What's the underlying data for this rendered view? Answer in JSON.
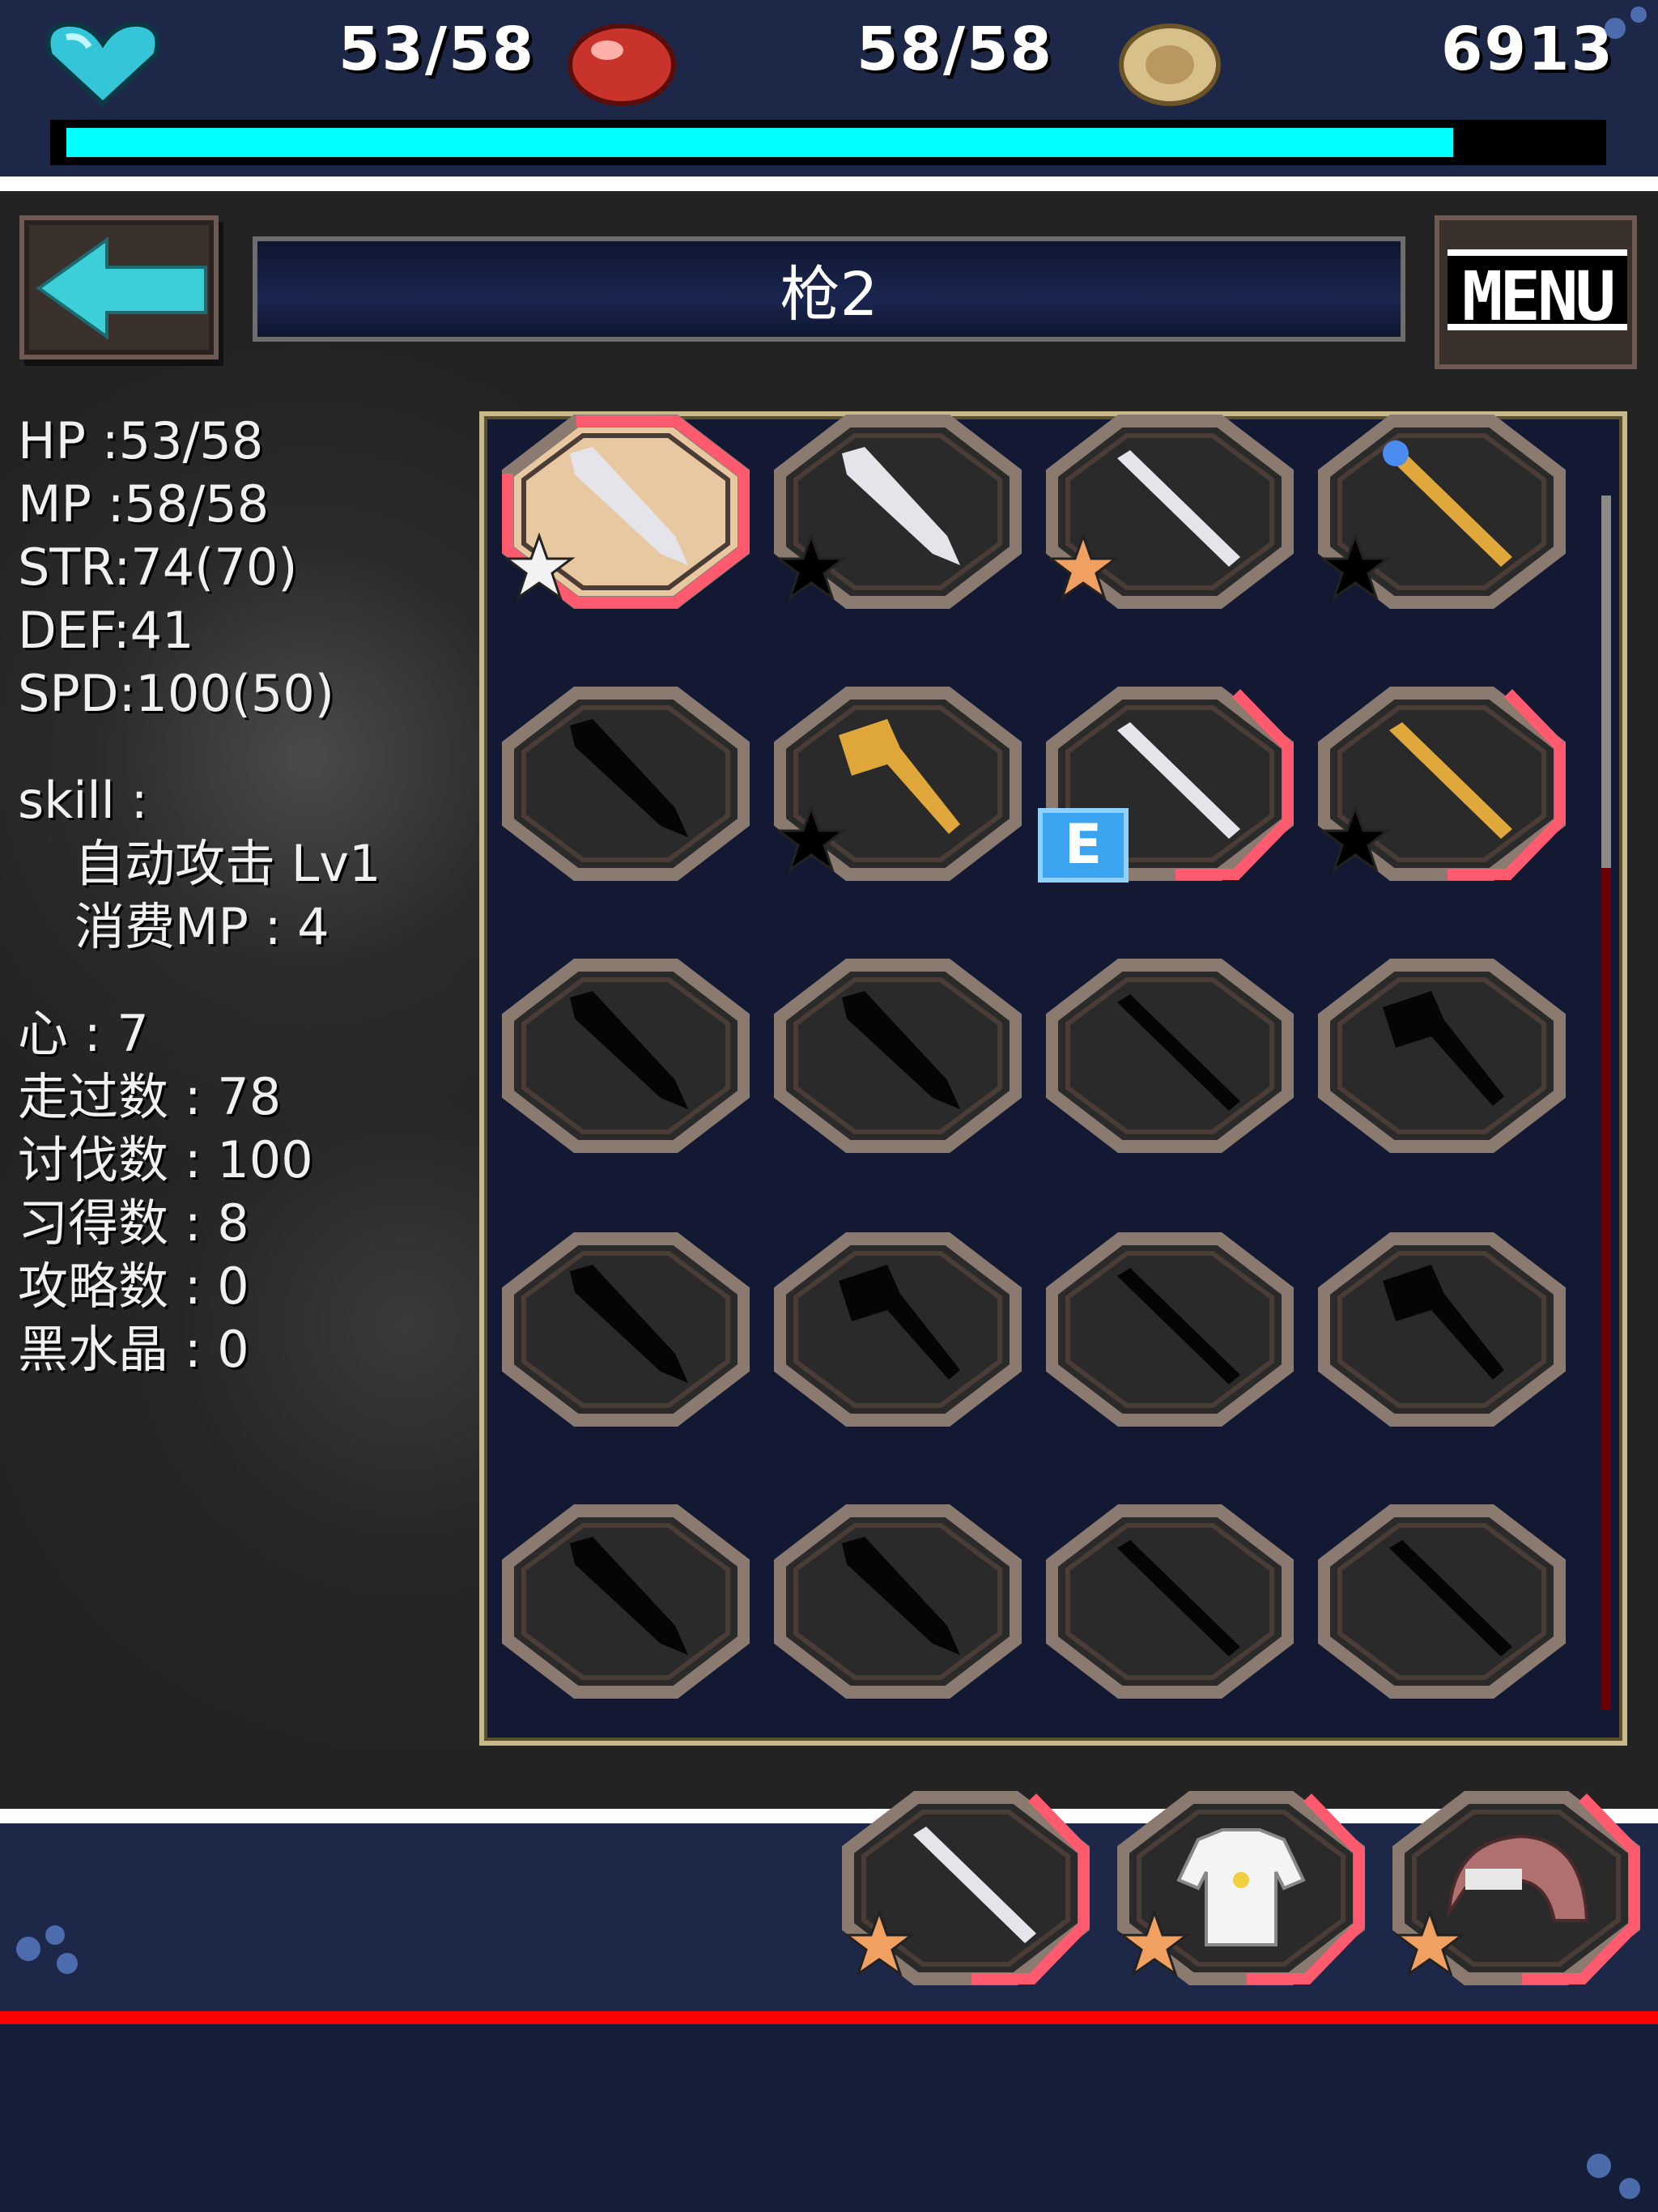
{
  "hud": {
    "hp_text": "53/58",
    "mp_text": "58/58",
    "gold_text": "6913",
    "exp_ratio": 0.91,
    "icons": [
      "heart-icon",
      "red-orb-icon",
      "gold-coin-icon"
    ]
  },
  "header": {
    "title": "枪2",
    "back_icon": "arrow-left-icon",
    "menu_label": "MENU"
  },
  "stats": {
    "hp": "HP :53/58",
    "mp": "MP :58/58",
    "str": "STR:74(70)",
    "def": "DEF:41",
    "spd": "SPD:100(50)",
    "skill_label": "skill :",
    "skill_name": "自动攻击 Lv1",
    "skill_cost": "消费MP : 4",
    "heart": "心 : 7",
    "walked": "走过数 : 78",
    "defeated": "讨伐数 : 100",
    "learned": "习得数 : 8",
    "cleared": "攻略数 : 0",
    "black_crystal": "黑水晶 : 0"
  },
  "inventory": {
    "equipped_tag": "E",
    "items": [
      {
        "icon": "knife-icon",
        "state": "selected",
        "star": "white"
      },
      {
        "icon": "broadsword-icon",
        "state": "owned",
        "star": "black"
      },
      {
        "icon": "spear-icon",
        "state": "owned",
        "star": "orange"
      },
      {
        "icon": "staff-icon",
        "state": "owned",
        "star": "black"
      },
      {
        "icon": "sword-icon",
        "state": "locked"
      },
      {
        "icon": "hammer-icon",
        "state": "owned",
        "star": "black"
      },
      {
        "icon": "lance-icon",
        "state": "equipped"
      },
      {
        "icon": "trident-icon",
        "state": "owned",
        "star": "black"
      },
      {
        "icon": "dagger-icon",
        "state": "locked"
      },
      {
        "icon": "greatsword-icon",
        "state": "locked"
      },
      {
        "icon": "spear-icon",
        "state": "locked"
      },
      {
        "icon": "club-icon",
        "state": "locked"
      },
      {
        "icon": "rapier-icon",
        "state": "locked"
      },
      {
        "icon": "axe-icon",
        "state": "locked"
      },
      {
        "icon": "fork-icon",
        "state": "locked"
      },
      {
        "icon": "mace-icon",
        "state": "locked"
      },
      {
        "icon": "shortsword-icon",
        "state": "locked"
      },
      {
        "icon": "bigsword-icon",
        "state": "locked"
      },
      {
        "icon": "cross-spear-icon",
        "state": "locked"
      },
      {
        "icon": "halberd-icon",
        "state": "locked"
      }
    ]
  },
  "equipped": [
    {
      "icon": "lance-icon",
      "star": "orange"
    },
    {
      "icon": "armor-icon",
      "star": "orange"
    },
    {
      "icon": "helmet-icon",
      "star": "orange"
    }
  ],
  "colors": {
    "exp": "#00ffff",
    "ring_red": "#ff5a6e",
    "star_orange": "#f0a060",
    "accent_red": "#ff0000"
  }
}
